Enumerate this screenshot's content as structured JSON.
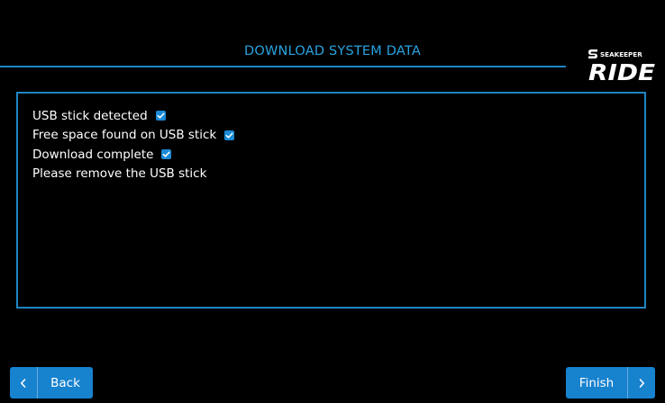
{
  "header": {
    "title": "DOWNLOAD SYSTEM DATA",
    "accent_color": "#29a3e0"
  },
  "logo": {
    "brand_small": "SEAKEEPER",
    "brand_large": "RIDE"
  },
  "status": {
    "items": [
      {
        "label": "USB stick detected",
        "checked": true,
        "icon": "checkbox-checked-icon"
      },
      {
        "label": "Free space found on USB stick",
        "checked": true,
        "icon": "checkbox-checked-icon"
      },
      {
        "label": "Download complete",
        "checked": true,
        "icon": "checkbox-checked-icon"
      },
      {
        "label": "Please remove the USB stick",
        "checked": false
      }
    ]
  },
  "footer": {
    "back_label": "Back",
    "back_icon": "chevron-left-icon",
    "finish_label": "Finish",
    "finish_icon": "chevron-right-icon",
    "button_color": "#1782ce"
  }
}
